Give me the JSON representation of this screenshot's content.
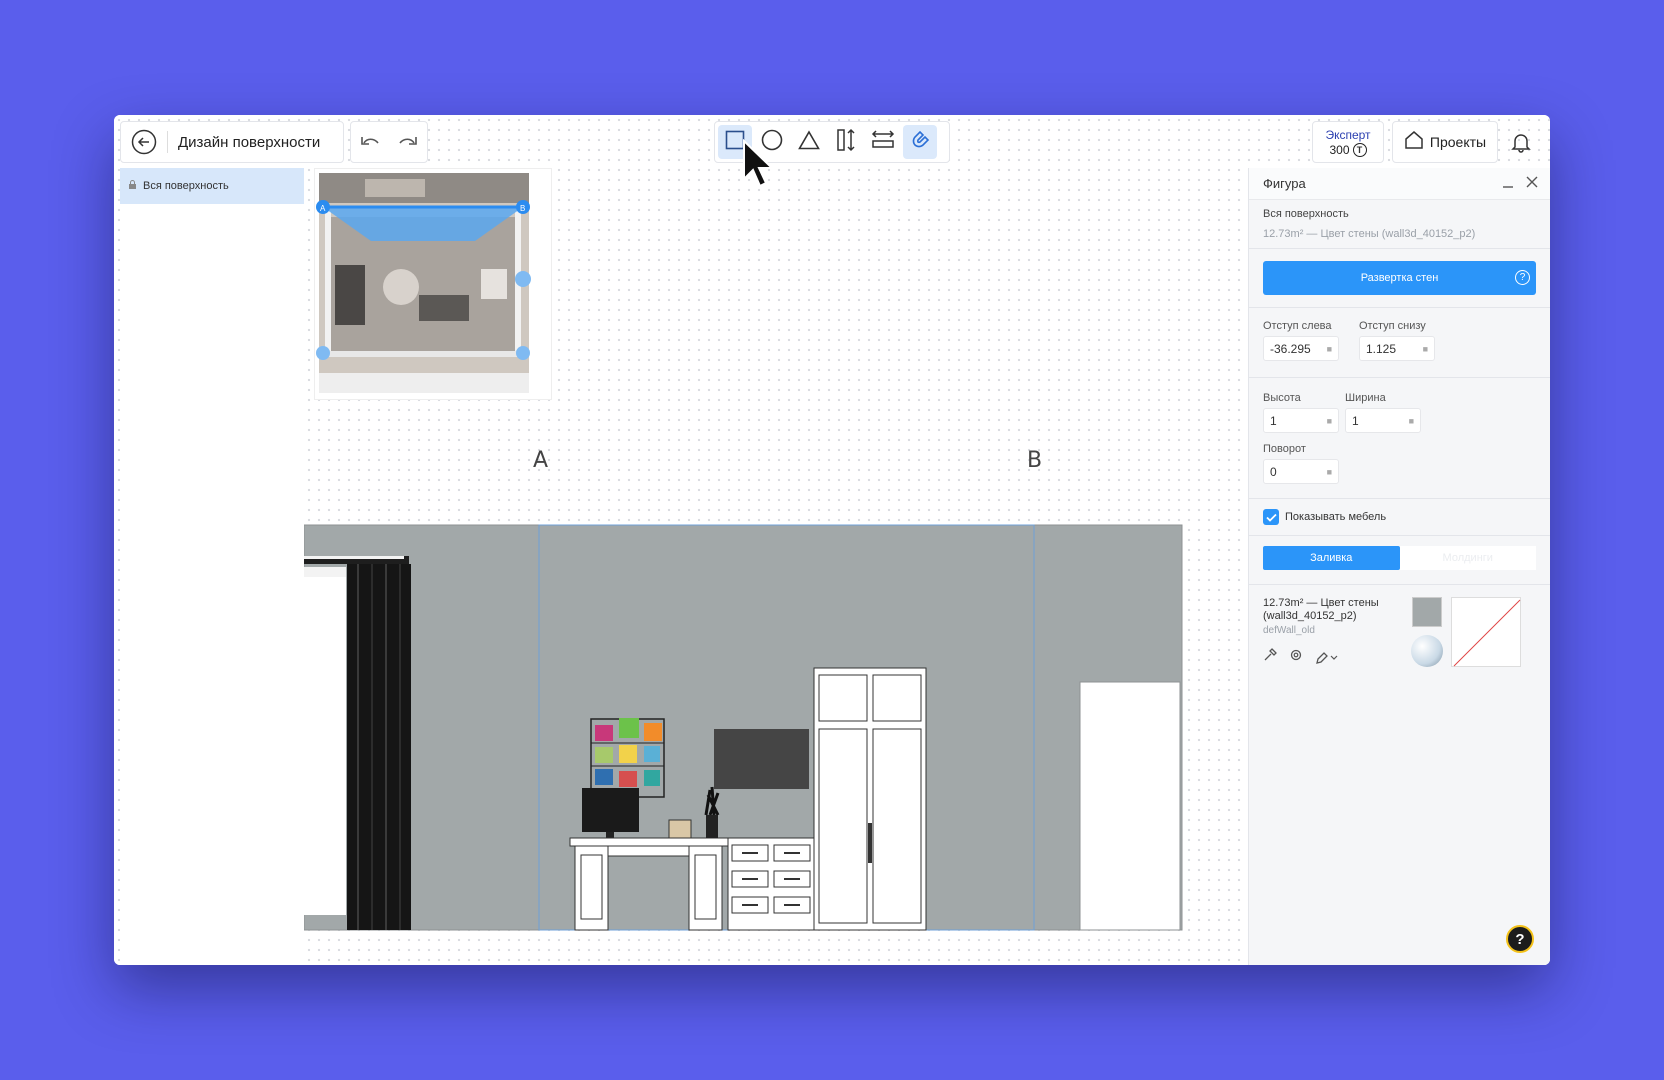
{
  "header": {
    "back_icon": "arrow-left-circle-icon",
    "title": "Дизайн поверхности",
    "undo_icon": "undo-icon",
    "redo_icon": "redo-icon"
  },
  "tools": [
    {
      "name": "rectangle-tool",
      "icon": "square-icon",
      "active": true
    },
    {
      "name": "circle-tool",
      "icon": "circle-icon",
      "active": false
    },
    {
      "name": "triangle-tool",
      "icon": "triangle-icon",
      "active": false
    },
    {
      "name": "vertical-distribute-tool",
      "icon": "vertical-arrows-icon",
      "active": false
    },
    {
      "name": "horizontal-distribute-tool",
      "icon": "horizontal-arrows-icon",
      "active": false
    },
    {
      "name": "magnet-tool",
      "icon": "magnet-icon",
      "active": true
    }
  ],
  "account": {
    "plan": "Эксперт",
    "balance": "300",
    "currency_icon": "tokens-icon",
    "projects_label": "Проекты",
    "bell_icon": "bell-icon"
  },
  "layers": {
    "item": "Вся поверхность"
  },
  "canvas": {
    "label_a": "A",
    "label_b": "B",
    "minimap_handles": [
      "A",
      "B"
    ]
  },
  "figure_panel": {
    "title": "Фигура",
    "surface_name": "Вся поверхность",
    "surface_info": "12.73m² — Цвет стены (wall3d_40152_p2)",
    "unfold_button": "Развертка стен",
    "offset_left_label": "Отступ слева",
    "offset_left_value": "-36.295",
    "offset_bottom_label": "Отступ снизу",
    "offset_bottom_value": "1.125",
    "height_label": "Высота",
    "height_value": "1",
    "width_label": "Ширина",
    "width_value": "1",
    "rotation_label": "Поворот",
    "rotation_value": "0",
    "show_furniture_label": "Показывать мебель",
    "show_furniture_checked": true,
    "tab_fill": "Заливка",
    "tab_other": "Молдинги",
    "material_title": "12.73m² — Цвет стены (wall3d_40152_p2)",
    "material_subtitle": "defWall_old"
  },
  "colors": {
    "accent": "#2b95f9",
    "wall": "#a2a8a9",
    "background": "#5a5eec"
  }
}
